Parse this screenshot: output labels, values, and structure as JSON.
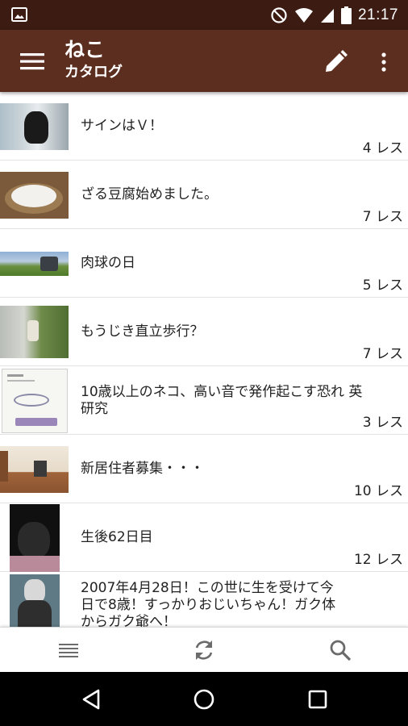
{
  "status_bar": {
    "time": "21:17",
    "icons": [
      "gallery-icon",
      "do-not-disturb-icon",
      "wifi-icon",
      "signal-icon",
      "battery-icon"
    ]
  },
  "app_bar": {
    "title": "ねこ",
    "subtitle": "カタログ",
    "icons": [
      "menu-icon",
      "edit-icon",
      "more-vert-icon"
    ]
  },
  "threads": [
    {
      "title": "サインはＶ！",
      "count": "4 レス"
    },
    {
      "title": "ざる豆腐始めました。",
      "count": "7 レス"
    },
    {
      "title": "肉球の日",
      "count": "5 レス"
    },
    {
      "title": "もうじき直立歩行？",
      "count": "7 レス"
    },
    {
      "title": "10歳以上のネコ、高い音で発作起こす恐れ 英研究",
      "count": "3 レス"
    },
    {
      "title": "新居住者募集・・・",
      "count": "10 レス"
    },
    {
      "title": "生後62日目",
      "count": "12 レス"
    },
    {
      "title": "2007年4月28日！この世に生を受けて今日で8歳！すっかりおじいちゃん！ガク体からガク爺へ！",
      "count": ""
    }
  ],
  "bottom_bar": {
    "icons": [
      "list-icon",
      "refresh-icon",
      "search-icon"
    ]
  },
  "nav_bar": {
    "icons": [
      "back-icon",
      "home-icon",
      "recents-icon"
    ]
  },
  "colors": {
    "status_bar": "#3b1b12",
    "app_bar": "#5b2e1f",
    "icon_gray": "#6b6b6b"
  }
}
